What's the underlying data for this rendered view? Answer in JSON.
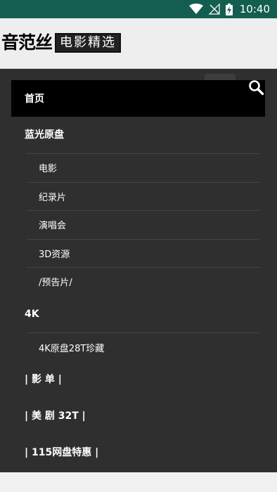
{
  "status_bar": {
    "time": "10:40",
    "icons": [
      "wifi-icon",
      "signal-off-icon",
      "battery-charging-icon"
    ]
  },
  "header": {
    "logo_main": "音范丝",
    "logo_sub": "电影精选"
  },
  "search": {
    "icon": "search-icon"
  },
  "nav": {
    "items": [
      {
        "label": "首页"
      },
      {
        "label": "蓝光原盘"
      },
      {
        "label": "4K"
      },
      {
        "label": "| 影 单 |"
      },
      {
        "label": "| 美 剧 32T |"
      },
      {
        "label": "| 115网盘特惠 |"
      }
    ],
    "bluray_sub": [
      {
        "label": "电影"
      },
      {
        "label": "纪录片"
      },
      {
        "label": "演唱会"
      },
      {
        "label": "3D资源"
      },
      {
        "label": "/预告片/"
      }
    ],
    "k4_sub": [
      {
        "label": "4K原盘28T珍藏"
      }
    ]
  },
  "colors": {
    "status_bar": "#135e4f",
    "panel": "#2f2f2f",
    "active": "#000000"
  }
}
